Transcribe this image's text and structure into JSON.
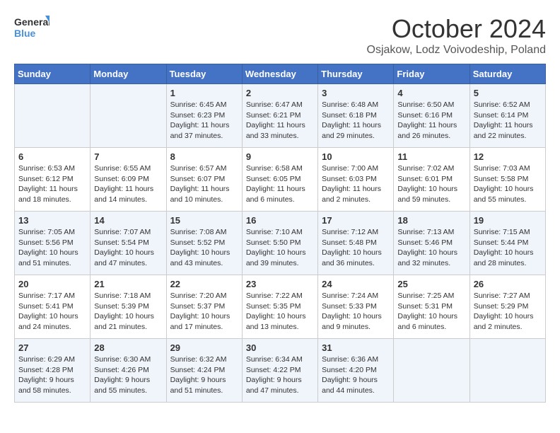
{
  "logo": {
    "line1": "General",
    "line2": "Blue"
  },
  "title": "October 2024",
  "subtitle": "Osjakow, Lodz Voivodeship, Poland",
  "weekdays": [
    "Sunday",
    "Monday",
    "Tuesday",
    "Wednesday",
    "Thursday",
    "Friday",
    "Saturday"
  ],
  "weeks": [
    [
      {
        "day": "",
        "info": ""
      },
      {
        "day": "",
        "info": ""
      },
      {
        "day": "1",
        "info": "Sunrise: 6:45 AM\nSunset: 6:23 PM\nDaylight: 11 hours\nand 37 minutes."
      },
      {
        "day": "2",
        "info": "Sunrise: 6:47 AM\nSunset: 6:21 PM\nDaylight: 11 hours\nand 33 minutes."
      },
      {
        "day": "3",
        "info": "Sunrise: 6:48 AM\nSunset: 6:18 PM\nDaylight: 11 hours\nand 29 minutes."
      },
      {
        "day": "4",
        "info": "Sunrise: 6:50 AM\nSunset: 6:16 PM\nDaylight: 11 hours\nand 26 minutes."
      },
      {
        "day": "5",
        "info": "Sunrise: 6:52 AM\nSunset: 6:14 PM\nDaylight: 11 hours\nand 22 minutes."
      }
    ],
    [
      {
        "day": "6",
        "info": "Sunrise: 6:53 AM\nSunset: 6:12 PM\nDaylight: 11 hours\nand 18 minutes."
      },
      {
        "day": "7",
        "info": "Sunrise: 6:55 AM\nSunset: 6:09 PM\nDaylight: 11 hours\nand 14 minutes."
      },
      {
        "day": "8",
        "info": "Sunrise: 6:57 AM\nSunset: 6:07 PM\nDaylight: 11 hours\nand 10 minutes."
      },
      {
        "day": "9",
        "info": "Sunrise: 6:58 AM\nSunset: 6:05 PM\nDaylight: 11 hours\nand 6 minutes."
      },
      {
        "day": "10",
        "info": "Sunrise: 7:00 AM\nSunset: 6:03 PM\nDaylight: 11 hours\nand 2 minutes."
      },
      {
        "day": "11",
        "info": "Sunrise: 7:02 AM\nSunset: 6:01 PM\nDaylight: 10 hours\nand 59 minutes."
      },
      {
        "day": "12",
        "info": "Sunrise: 7:03 AM\nSunset: 5:58 PM\nDaylight: 10 hours\nand 55 minutes."
      }
    ],
    [
      {
        "day": "13",
        "info": "Sunrise: 7:05 AM\nSunset: 5:56 PM\nDaylight: 10 hours\nand 51 minutes."
      },
      {
        "day": "14",
        "info": "Sunrise: 7:07 AM\nSunset: 5:54 PM\nDaylight: 10 hours\nand 47 minutes."
      },
      {
        "day": "15",
        "info": "Sunrise: 7:08 AM\nSunset: 5:52 PM\nDaylight: 10 hours\nand 43 minutes."
      },
      {
        "day": "16",
        "info": "Sunrise: 7:10 AM\nSunset: 5:50 PM\nDaylight: 10 hours\nand 39 minutes."
      },
      {
        "day": "17",
        "info": "Sunrise: 7:12 AM\nSunset: 5:48 PM\nDaylight: 10 hours\nand 36 minutes."
      },
      {
        "day": "18",
        "info": "Sunrise: 7:13 AM\nSunset: 5:46 PM\nDaylight: 10 hours\nand 32 minutes."
      },
      {
        "day": "19",
        "info": "Sunrise: 7:15 AM\nSunset: 5:44 PM\nDaylight: 10 hours\nand 28 minutes."
      }
    ],
    [
      {
        "day": "20",
        "info": "Sunrise: 7:17 AM\nSunset: 5:41 PM\nDaylight: 10 hours\nand 24 minutes."
      },
      {
        "day": "21",
        "info": "Sunrise: 7:18 AM\nSunset: 5:39 PM\nDaylight: 10 hours\nand 21 minutes."
      },
      {
        "day": "22",
        "info": "Sunrise: 7:20 AM\nSunset: 5:37 PM\nDaylight: 10 hours\nand 17 minutes."
      },
      {
        "day": "23",
        "info": "Sunrise: 7:22 AM\nSunset: 5:35 PM\nDaylight: 10 hours\nand 13 minutes."
      },
      {
        "day": "24",
        "info": "Sunrise: 7:24 AM\nSunset: 5:33 PM\nDaylight: 10 hours\nand 9 minutes."
      },
      {
        "day": "25",
        "info": "Sunrise: 7:25 AM\nSunset: 5:31 PM\nDaylight: 10 hours\nand 6 minutes."
      },
      {
        "day": "26",
        "info": "Sunrise: 7:27 AM\nSunset: 5:29 PM\nDaylight: 10 hours\nand 2 minutes."
      }
    ],
    [
      {
        "day": "27",
        "info": "Sunrise: 6:29 AM\nSunset: 4:28 PM\nDaylight: 9 hours\nand 58 minutes."
      },
      {
        "day": "28",
        "info": "Sunrise: 6:30 AM\nSunset: 4:26 PM\nDaylight: 9 hours\nand 55 minutes."
      },
      {
        "day": "29",
        "info": "Sunrise: 6:32 AM\nSunset: 4:24 PM\nDaylight: 9 hours\nand 51 minutes."
      },
      {
        "day": "30",
        "info": "Sunrise: 6:34 AM\nSunset: 4:22 PM\nDaylight: 9 hours\nand 47 minutes."
      },
      {
        "day": "31",
        "info": "Sunrise: 6:36 AM\nSunset: 4:20 PM\nDaylight: 9 hours\nand 44 minutes."
      },
      {
        "day": "",
        "info": ""
      },
      {
        "day": "",
        "info": ""
      }
    ]
  ]
}
